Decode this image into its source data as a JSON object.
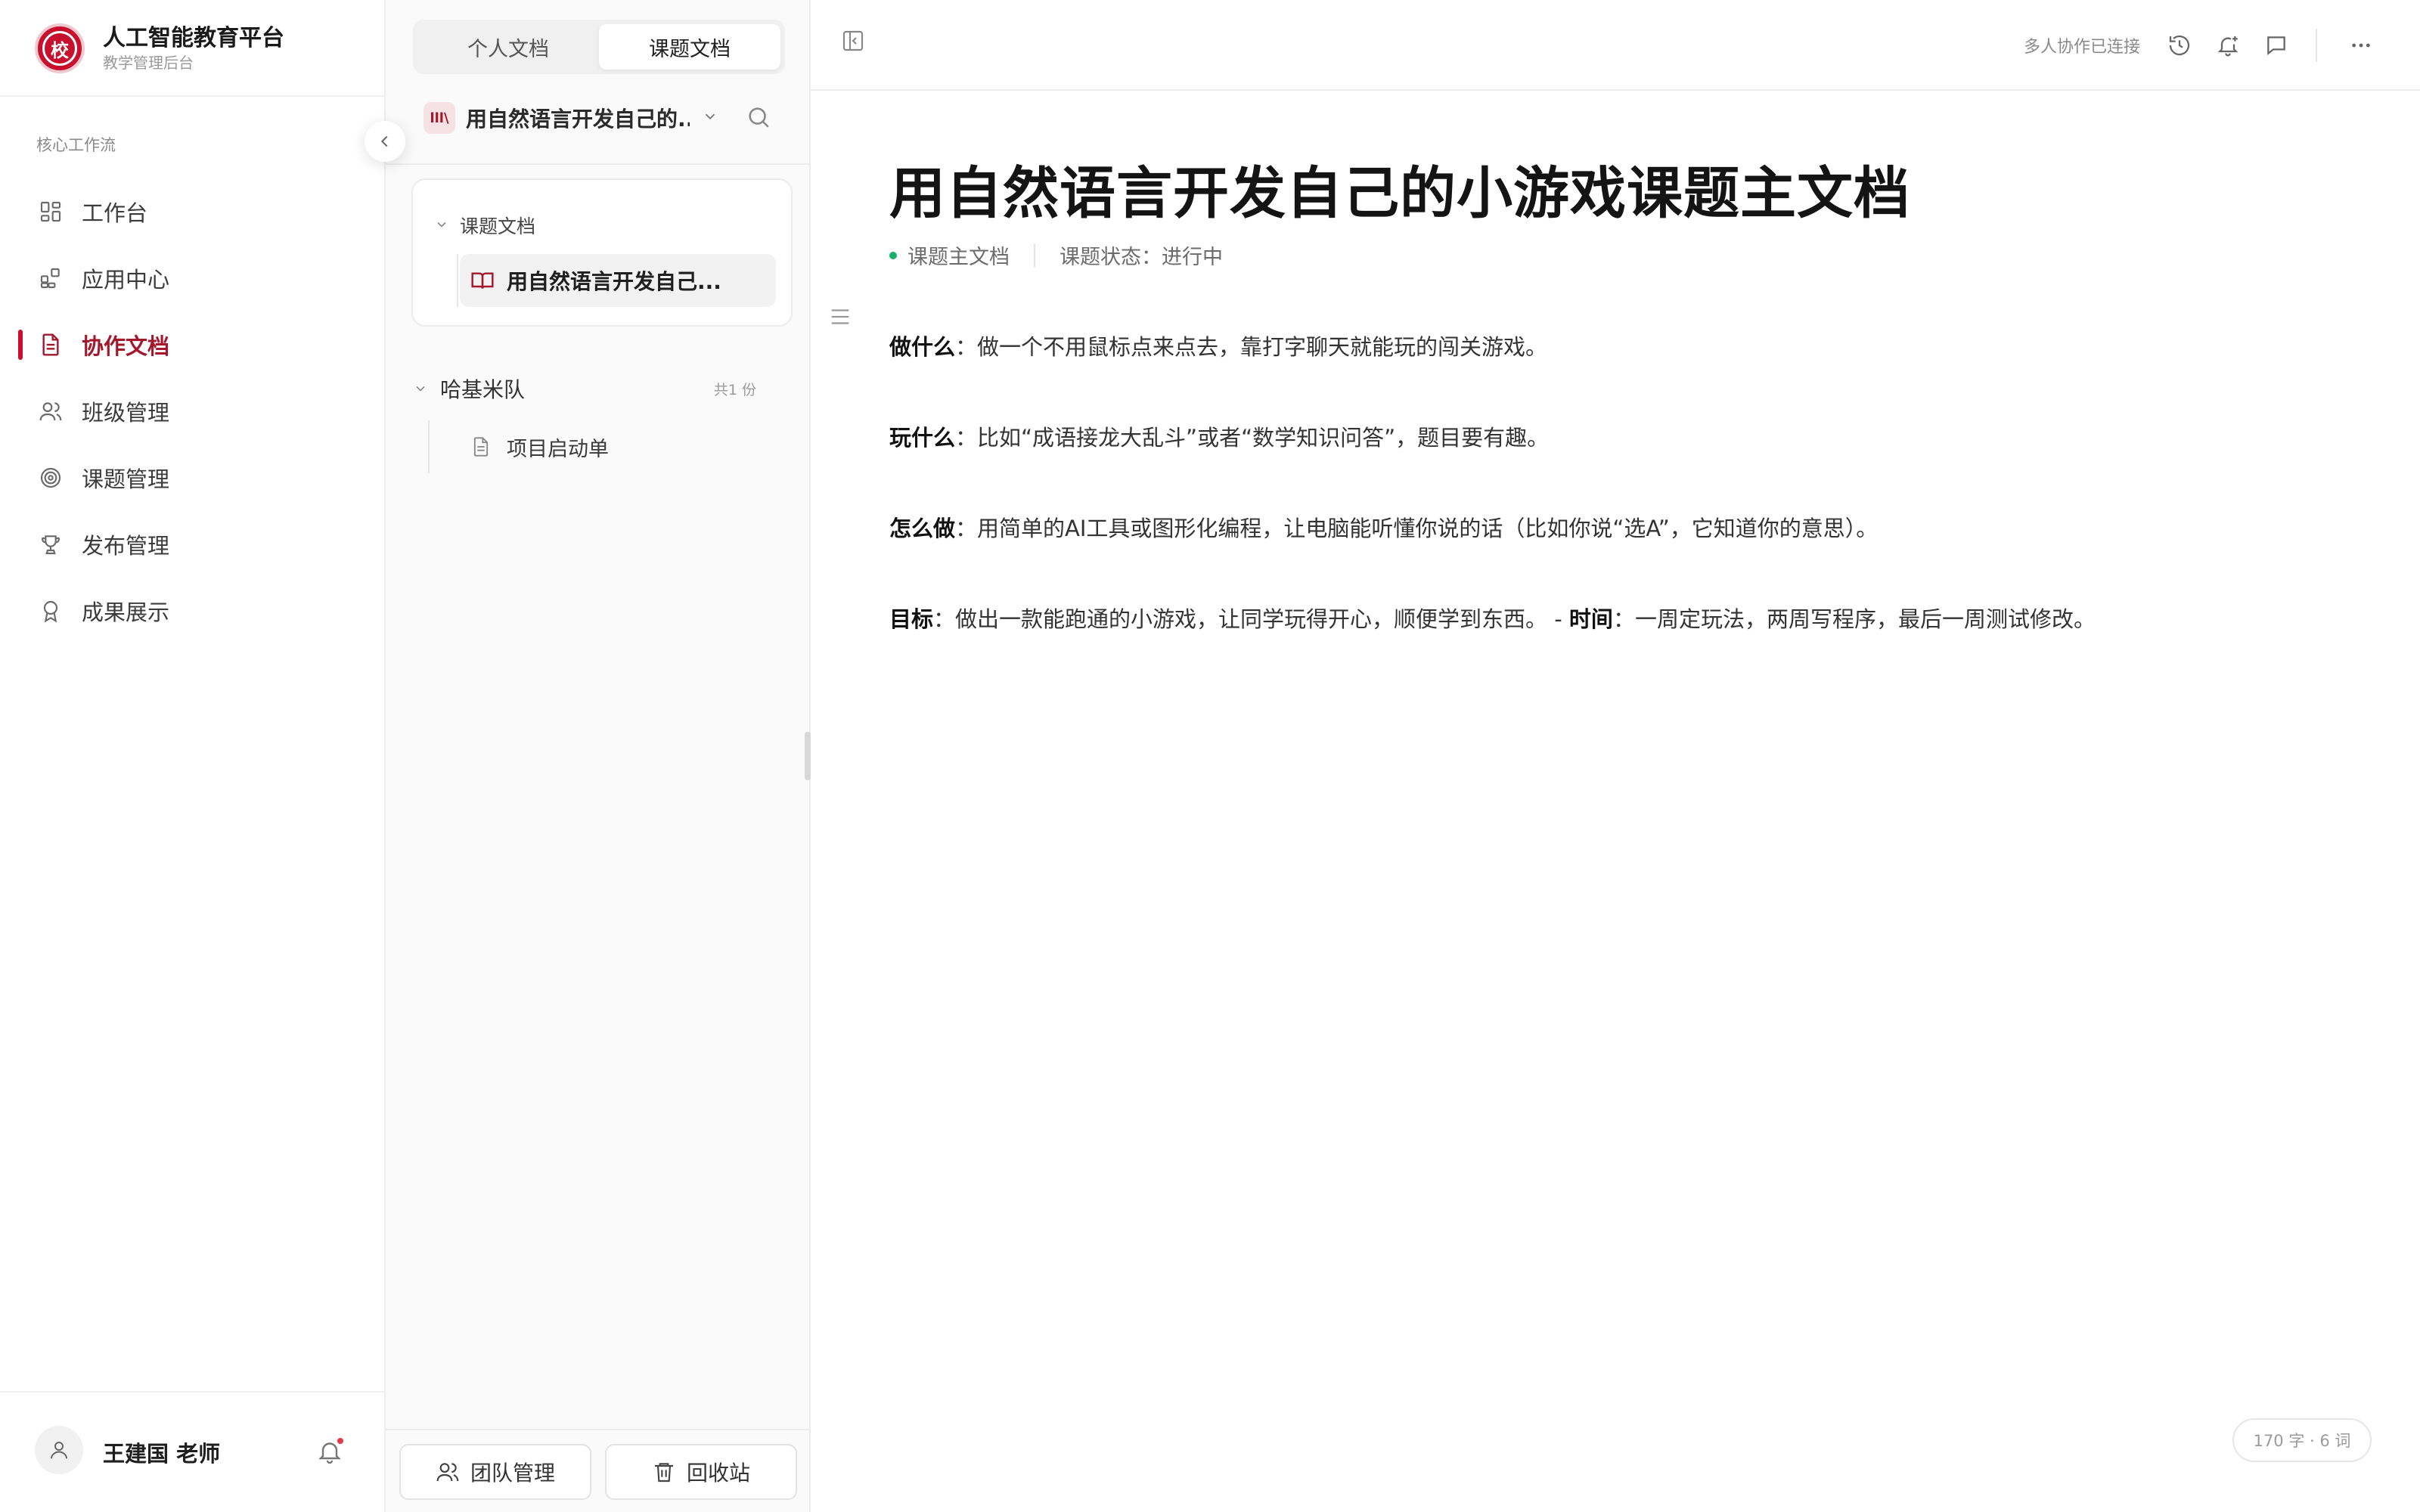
{
  "brand": {
    "title": "人工智能教育平台",
    "subtitle": "教学管理后台",
    "logo_glyph": "校",
    "primary_color": "#c8102e"
  },
  "sidebar": {
    "section_label": "核心工作流",
    "items": [
      {
        "label": "工作台",
        "icon": "dashboard-icon",
        "active": false
      },
      {
        "label": "应用中心",
        "icon": "apps-icon",
        "active": false
      },
      {
        "label": "协作文档",
        "icon": "document-icon",
        "active": true
      },
      {
        "label": "班级管理",
        "icon": "users-icon",
        "active": false
      },
      {
        "label": "课题管理",
        "icon": "target-icon",
        "active": false
      },
      {
        "label": "发布管理",
        "icon": "trophy-icon",
        "active": false
      },
      {
        "label": "成果展示",
        "icon": "award-icon",
        "active": false
      }
    ],
    "user": {
      "name": "王建国 老师",
      "has_notification": true
    }
  },
  "doc_panel": {
    "tabs": [
      {
        "label": "个人文档",
        "active": false
      },
      {
        "label": "课题文档",
        "active": true
      }
    ],
    "project": {
      "icon_text": "lll\\",
      "name": "用自然语言开发自己的..."
    },
    "tree": {
      "section_label": "课题文档",
      "active_doc": "用自然语言开发自己..."
    },
    "group": {
      "name": "哈基米队",
      "count": "共1 份",
      "files": [
        "项目启动单"
      ]
    },
    "footer": {
      "team_label": "团队管理",
      "trash_label": "回收站"
    }
  },
  "topbar": {
    "collab_status": "多人协作已连接"
  },
  "document": {
    "title": "用自然语言开发自己的小游戏课题主文档",
    "meta_type": "课题主文档",
    "meta_status": "课题状态：进行中",
    "paragraphs": [
      {
        "label": "做什么",
        "text": "：做一个不用鼠标点来点去，靠打字聊天就能玩的闯关游戏。"
      },
      {
        "label": "玩什么",
        "text": "：比如“成语接龙大乱斗”或者“数学知识问答”，题目要有趣。"
      },
      {
        "label": "怎么做",
        "text": "：用简单的AI工具或图形化编程，让电脑能听懂你说的话（比如你说“选A”，它知道你的意思）。"
      },
      {
        "label": "目标",
        "text": "：做出一款能跑通的小游戏，让同学玩得开心，顺便学到东西。 - ",
        "label2": "时间",
        "text2": "：一周定玩法，两周写程序，最后一周测试修改。"
      }
    ],
    "word_count": "170 字 · 6 词"
  }
}
